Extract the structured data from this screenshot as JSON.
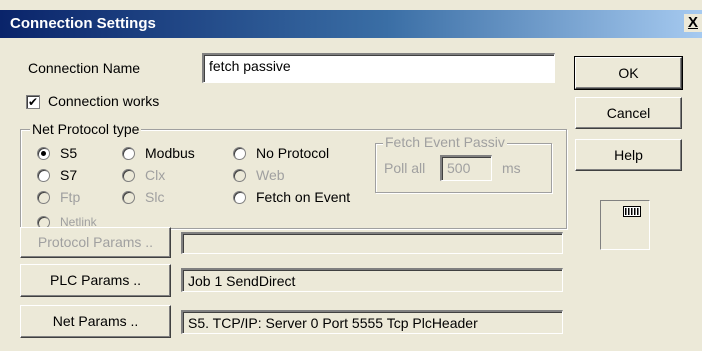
{
  "window": {
    "title": "Connection Settings",
    "close_label": "X"
  },
  "connection_name": {
    "label": "Connection Name",
    "value": "fetch passive"
  },
  "connection_works": {
    "label": "Connection works",
    "checked": true
  },
  "net_protocol": {
    "group_label": "Net Protocol type",
    "options": {
      "s5": "S5",
      "s7": "S7",
      "ftp": "Ftp",
      "netlink": "Netlink",
      "modbus": "Modbus",
      "clx": "Clx",
      "slc": "Slc",
      "no_protocol": "No Protocol",
      "web": "Web",
      "fetch_on_event": "Fetch on Event"
    },
    "selected": "S5"
  },
  "fetch_event_passive": {
    "group_label": "Fetch Event Passiv",
    "poll_label": "Poll all",
    "poll_value": "500",
    "unit": "ms"
  },
  "buttons": {
    "ok": "OK",
    "cancel": "Cancel",
    "help": "Help",
    "protocol_params": "Protocol Params ..",
    "plc_params": "PLC Params ..",
    "net_params": "Net Params .."
  },
  "fields": {
    "protocol_params_value": "",
    "plc_params_value": "Job 1 SendDirect",
    "net_params_value": "S5. TCP/IP: Server 0 Port 5555 Tcp  PlcHeader"
  },
  "icons": {
    "device": "plc-device-icon"
  }
}
